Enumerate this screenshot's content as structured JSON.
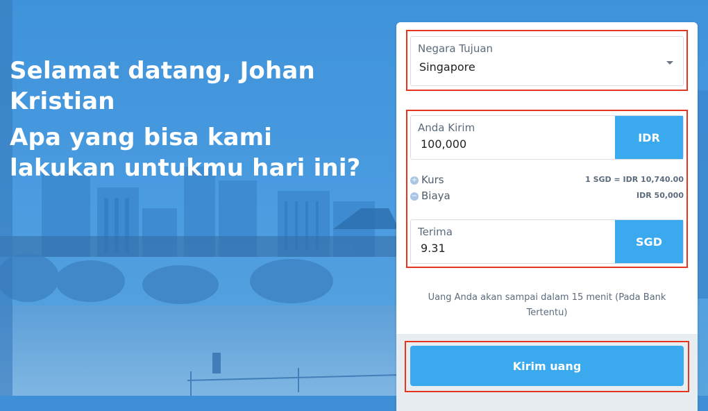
{
  "welcome": {
    "greeting": "Selamat datang, Johan Kristian",
    "question": "Apa yang bisa kami lakukan untukmu hari ini?"
  },
  "form": {
    "country": {
      "label": "Negara Tujuan",
      "value": "Singapore"
    },
    "send": {
      "label": "Anda Kirim",
      "value": "100,000",
      "currency": "IDR"
    },
    "rate": {
      "label": "Kurs",
      "value": "1 SGD = IDR 10,740.00"
    },
    "fee": {
      "label": "Biaya",
      "value": "IDR 50,000"
    },
    "receive": {
      "label": "Terima",
      "value": "9.31",
      "currency": "SGD"
    },
    "note": "Uang Anda akan sampai dalam 15 menit (Pada Bank Tertentu)",
    "submit_label": "Kirim uang"
  },
  "colors": {
    "accent": "#3aa9ee",
    "highlight": "#e5351f",
    "background": "#3f8fd6"
  }
}
